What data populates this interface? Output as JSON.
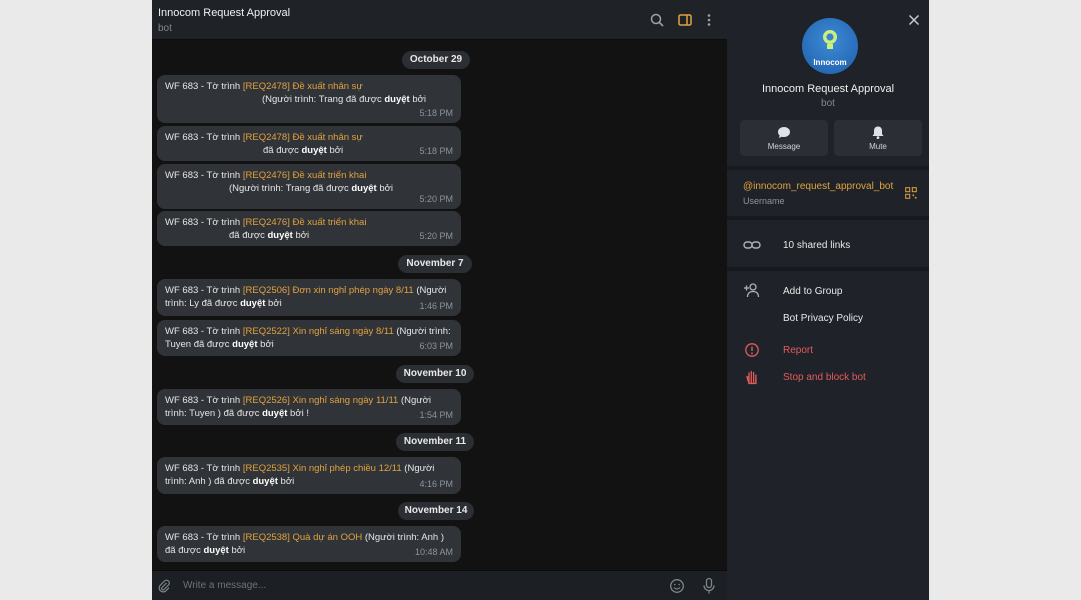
{
  "header": {
    "title": "Innocom Request Approval",
    "subtitle": "bot"
  },
  "messages": [
    {
      "date": "October 29"
    },
    {
      "prefix": "WF 683 - Tờ trình ",
      "req": "[REQ2478] Đề xuất nhân sự",
      "line2": "(Người trình: Trang       đã được ",
      "bold": "duyệt",
      "tail": " bởi",
      "time": "5:18 PM"
    },
    {
      "prefix": "WF 683 - Tờ trình ",
      "req": "[REQ2478] Đề xuất nhân sự",
      "line2": "đã được ",
      "bold": "duyệt",
      "tail": " bởi",
      "time": "5:18 PM"
    },
    {
      "prefix": "WF 683 - Tờ trình ",
      "req": "[REQ2476] Đề xuất triển khai",
      "line2": "(Người trình: Trang       đã được ",
      "bold": "duyệt",
      "tail": " bởi",
      "time": "5:20 PM"
    },
    {
      "prefix": "WF 683 - Tờ trình ",
      "req": "[REQ2476] Đề xuất triển khai",
      "line2": "đã được ",
      "bold": "duyệt",
      "tail": " bởi",
      "time": "5:20 PM"
    },
    {
      "date": "November 7"
    },
    {
      "prefix": "WF 683 - Tờ trình ",
      "req": "[REQ2506] Đơn xin nghỉ phép ngày 8/11",
      "suffix": " (Người",
      "line2": "trình: Ly        đã được ",
      "bold": "duyệt",
      "tail": " bởi",
      "time": "1:46 PM"
    },
    {
      "prefix": "WF 683 - Tờ trình ",
      "req": "[REQ2522] Xin nghỉ sáng ngày 8/11",
      "suffix": " (Người trình:",
      "line2": "Tuyen         đã được ",
      "bold": "duyệt",
      "tail": " bởi",
      "time": "6:03 PM"
    },
    {
      "date": "November 10"
    },
    {
      "prefix": "WF 683 - Tờ trình ",
      "req": "[REQ2526] Xin nghỉ sáng ngày 11/11",
      "suffix": " (Người",
      "line2": "trình: Tuyen       ) đã được ",
      "bold": "duyệt",
      "tail": " bởi !",
      "time": "1:54 PM"
    },
    {
      "date": "November 11"
    },
    {
      "prefix": "WF 683 - Tờ trình ",
      "req": "[REQ2535] Xin nghỉ phép chiều 12/11",
      "suffix": " (Người",
      "line2": "trình: Anh         ) đã được ",
      "bold": "duyệt",
      "tail": " bởi",
      "time": "4:16 PM"
    },
    {
      "date": "November 14"
    },
    {
      "prefix": "WF 683 - Tờ trình ",
      "req": "[REQ2538] Quà dự án OOH",
      "suffix": " (Người trình: Anh     )",
      "line2": "đã được ",
      "bold": "duyệt",
      "tail": " bởi",
      "time": "10:48 AM"
    }
  ],
  "input": {
    "placeholder": "Write a message..."
  },
  "side": {
    "avatar_text": "Innocom",
    "name": "Innocom Request Approval",
    "subtitle": "bot",
    "message_label": "Message",
    "mute_label": "Mute",
    "username": "@innocom_request_approval_bot",
    "username_label": "Username",
    "shared_links": "10 shared links",
    "add_to_group": "Add to Group",
    "privacy": "Bot Privacy Policy",
    "report": "Report",
    "stop_block": "Stop and block bot"
  },
  "colors": {
    "accent": "#e2a33f",
    "danger": "#e35b5b",
    "bubble": "#303338"
  }
}
